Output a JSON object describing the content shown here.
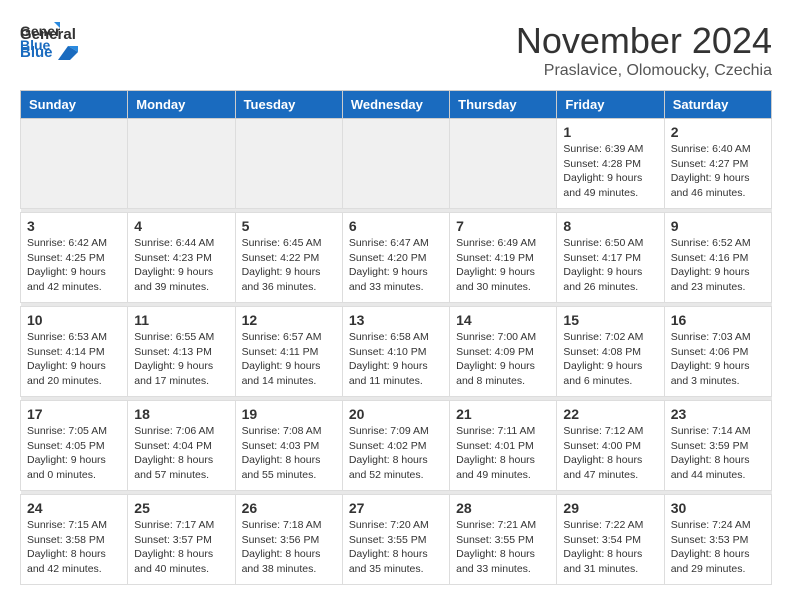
{
  "header": {
    "logo_general": "General",
    "logo_blue": "Blue",
    "title": "November 2024",
    "location": "Praslavice, Olomoucky, Czechia"
  },
  "days_of_week": [
    "Sunday",
    "Monday",
    "Tuesday",
    "Wednesday",
    "Thursday",
    "Friday",
    "Saturday"
  ],
  "weeks": [
    {
      "days": [
        {
          "date": "",
          "info": ""
        },
        {
          "date": "",
          "info": ""
        },
        {
          "date": "",
          "info": ""
        },
        {
          "date": "",
          "info": ""
        },
        {
          "date": "",
          "info": ""
        },
        {
          "date": "1",
          "info": "Sunrise: 6:39 AM\nSunset: 4:28 PM\nDaylight: 9 hours and 49 minutes."
        },
        {
          "date": "2",
          "info": "Sunrise: 6:40 AM\nSunset: 4:27 PM\nDaylight: 9 hours and 46 minutes."
        }
      ]
    },
    {
      "days": [
        {
          "date": "3",
          "info": "Sunrise: 6:42 AM\nSunset: 4:25 PM\nDaylight: 9 hours and 42 minutes."
        },
        {
          "date": "4",
          "info": "Sunrise: 6:44 AM\nSunset: 4:23 PM\nDaylight: 9 hours and 39 minutes."
        },
        {
          "date": "5",
          "info": "Sunrise: 6:45 AM\nSunset: 4:22 PM\nDaylight: 9 hours and 36 minutes."
        },
        {
          "date": "6",
          "info": "Sunrise: 6:47 AM\nSunset: 4:20 PM\nDaylight: 9 hours and 33 minutes."
        },
        {
          "date": "7",
          "info": "Sunrise: 6:49 AM\nSunset: 4:19 PM\nDaylight: 9 hours and 30 minutes."
        },
        {
          "date": "8",
          "info": "Sunrise: 6:50 AM\nSunset: 4:17 PM\nDaylight: 9 hours and 26 minutes."
        },
        {
          "date": "9",
          "info": "Sunrise: 6:52 AM\nSunset: 4:16 PM\nDaylight: 9 hours and 23 minutes."
        }
      ]
    },
    {
      "days": [
        {
          "date": "10",
          "info": "Sunrise: 6:53 AM\nSunset: 4:14 PM\nDaylight: 9 hours and 20 minutes."
        },
        {
          "date": "11",
          "info": "Sunrise: 6:55 AM\nSunset: 4:13 PM\nDaylight: 9 hours and 17 minutes."
        },
        {
          "date": "12",
          "info": "Sunrise: 6:57 AM\nSunset: 4:11 PM\nDaylight: 9 hours and 14 minutes."
        },
        {
          "date": "13",
          "info": "Sunrise: 6:58 AM\nSunset: 4:10 PM\nDaylight: 9 hours and 11 minutes."
        },
        {
          "date": "14",
          "info": "Sunrise: 7:00 AM\nSunset: 4:09 PM\nDaylight: 9 hours and 8 minutes."
        },
        {
          "date": "15",
          "info": "Sunrise: 7:02 AM\nSunset: 4:08 PM\nDaylight: 9 hours and 6 minutes."
        },
        {
          "date": "16",
          "info": "Sunrise: 7:03 AM\nSunset: 4:06 PM\nDaylight: 9 hours and 3 minutes."
        }
      ]
    },
    {
      "days": [
        {
          "date": "17",
          "info": "Sunrise: 7:05 AM\nSunset: 4:05 PM\nDaylight: 9 hours and 0 minutes."
        },
        {
          "date": "18",
          "info": "Sunrise: 7:06 AM\nSunset: 4:04 PM\nDaylight: 8 hours and 57 minutes."
        },
        {
          "date": "19",
          "info": "Sunrise: 7:08 AM\nSunset: 4:03 PM\nDaylight: 8 hours and 55 minutes."
        },
        {
          "date": "20",
          "info": "Sunrise: 7:09 AM\nSunset: 4:02 PM\nDaylight: 8 hours and 52 minutes."
        },
        {
          "date": "21",
          "info": "Sunrise: 7:11 AM\nSunset: 4:01 PM\nDaylight: 8 hours and 49 minutes."
        },
        {
          "date": "22",
          "info": "Sunrise: 7:12 AM\nSunset: 4:00 PM\nDaylight: 8 hours and 47 minutes."
        },
        {
          "date": "23",
          "info": "Sunrise: 7:14 AM\nSunset: 3:59 PM\nDaylight: 8 hours and 44 minutes."
        }
      ]
    },
    {
      "days": [
        {
          "date": "24",
          "info": "Sunrise: 7:15 AM\nSunset: 3:58 PM\nDaylight: 8 hours and 42 minutes."
        },
        {
          "date": "25",
          "info": "Sunrise: 7:17 AM\nSunset: 3:57 PM\nDaylight: 8 hours and 40 minutes."
        },
        {
          "date": "26",
          "info": "Sunrise: 7:18 AM\nSunset: 3:56 PM\nDaylight: 8 hours and 38 minutes."
        },
        {
          "date": "27",
          "info": "Sunrise: 7:20 AM\nSunset: 3:55 PM\nDaylight: 8 hours and 35 minutes."
        },
        {
          "date": "28",
          "info": "Sunrise: 7:21 AM\nSunset: 3:55 PM\nDaylight: 8 hours and 33 minutes."
        },
        {
          "date": "29",
          "info": "Sunrise: 7:22 AM\nSunset: 3:54 PM\nDaylight: 8 hours and 31 minutes."
        },
        {
          "date": "30",
          "info": "Sunrise: 7:24 AM\nSunset: 3:53 PM\nDaylight: 8 hours and 29 minutes."
        }
      ]
    }
  ]
}
